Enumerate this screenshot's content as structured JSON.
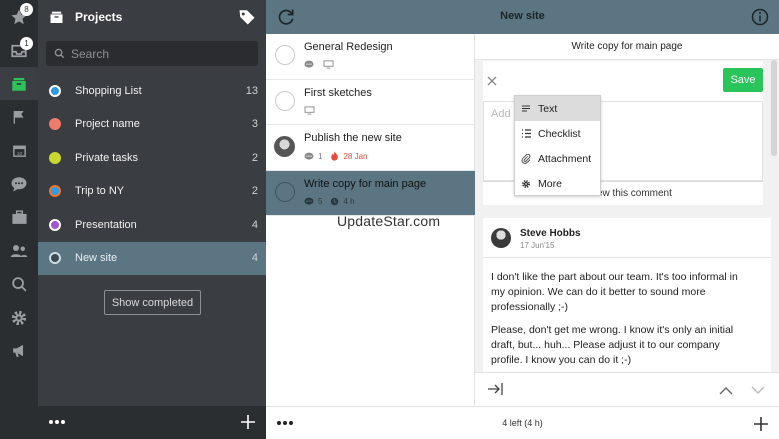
{
  "rail": {
    "badges": {
      "star": "8",
      "inbox": "1"
    }
  },
  "projects_panel": {
    "title": "Projects",
    "search_placeholder": "Search",
    "items": [
      {
        "name": "Shopping List",
        "count": "13",
        "color": "#2d9be8"
      },
      {
        "name": "Project name",
        "count": "3",
        "color": "#f07b6b"
      },
      {
        "name": "Private tasks",
        "count": "2",
        "color": "#c9d82f"
      },
      {
        "name": "Trip to NY",
        "count": "2",
        "color": "#f0762b"
      },
      {
        "name": "Presentation",
        "count": "4",
        "color": "#a054d6"
      },
      {
        "name": "New site",
        "count": "4",
        "color": "#5b7682"
      }
    ],
    "show_completed": "Show completed"
  },
  "topbar": {
    "title": "New site"
  },
  "tasks": [
    {
      "title": "General Redesign",
      "comments": "",
      "due": "",
      "duration": ""
    },
    {
      "title": "First sketches",
      "comments": "",
      "due": "",
      "duration": ""
    },
    {
      "title": "Publish the new site",
      "comments": "1",
      "due": "28 Jan",
      "duration": ""
    },
    {
      "title": "Write copy for main page",
      "comments": "5",
      "due": "",
      "duration": "4 h"
    }
  ],
  "list_footer": {
    "status": "4 left (4 h)"
  },
  "detail": {
    "title": "Write copy for main page",
    "save_label": "Save",
    "add_placeholder": "Add",
    "preview_label": "Preview this comment",
    "menu": [
      "Text",
      "Checklist",
      "Attachment",
      "More"
    ],
    "comment": {
      "author": "Steve Hobbs",
      "date": "17 Jun'15",
      "paragraph1": "I don't like the part about our team. It's too informal in my opinion. We can do it better to sound more professionally ;-)",
      "paragraph2": "Please, don't get me wrong. I know it's only an initial draft, but... huh... Please adjust it to our company profile. I know you can do it ;-)"
    }
  },
  "watermark": "UpdateStar.com",
  "colors": {
    "accent": "#5b7682",
    "save": "#29c45a",
    "due": "#e34d3b"
  }
}
